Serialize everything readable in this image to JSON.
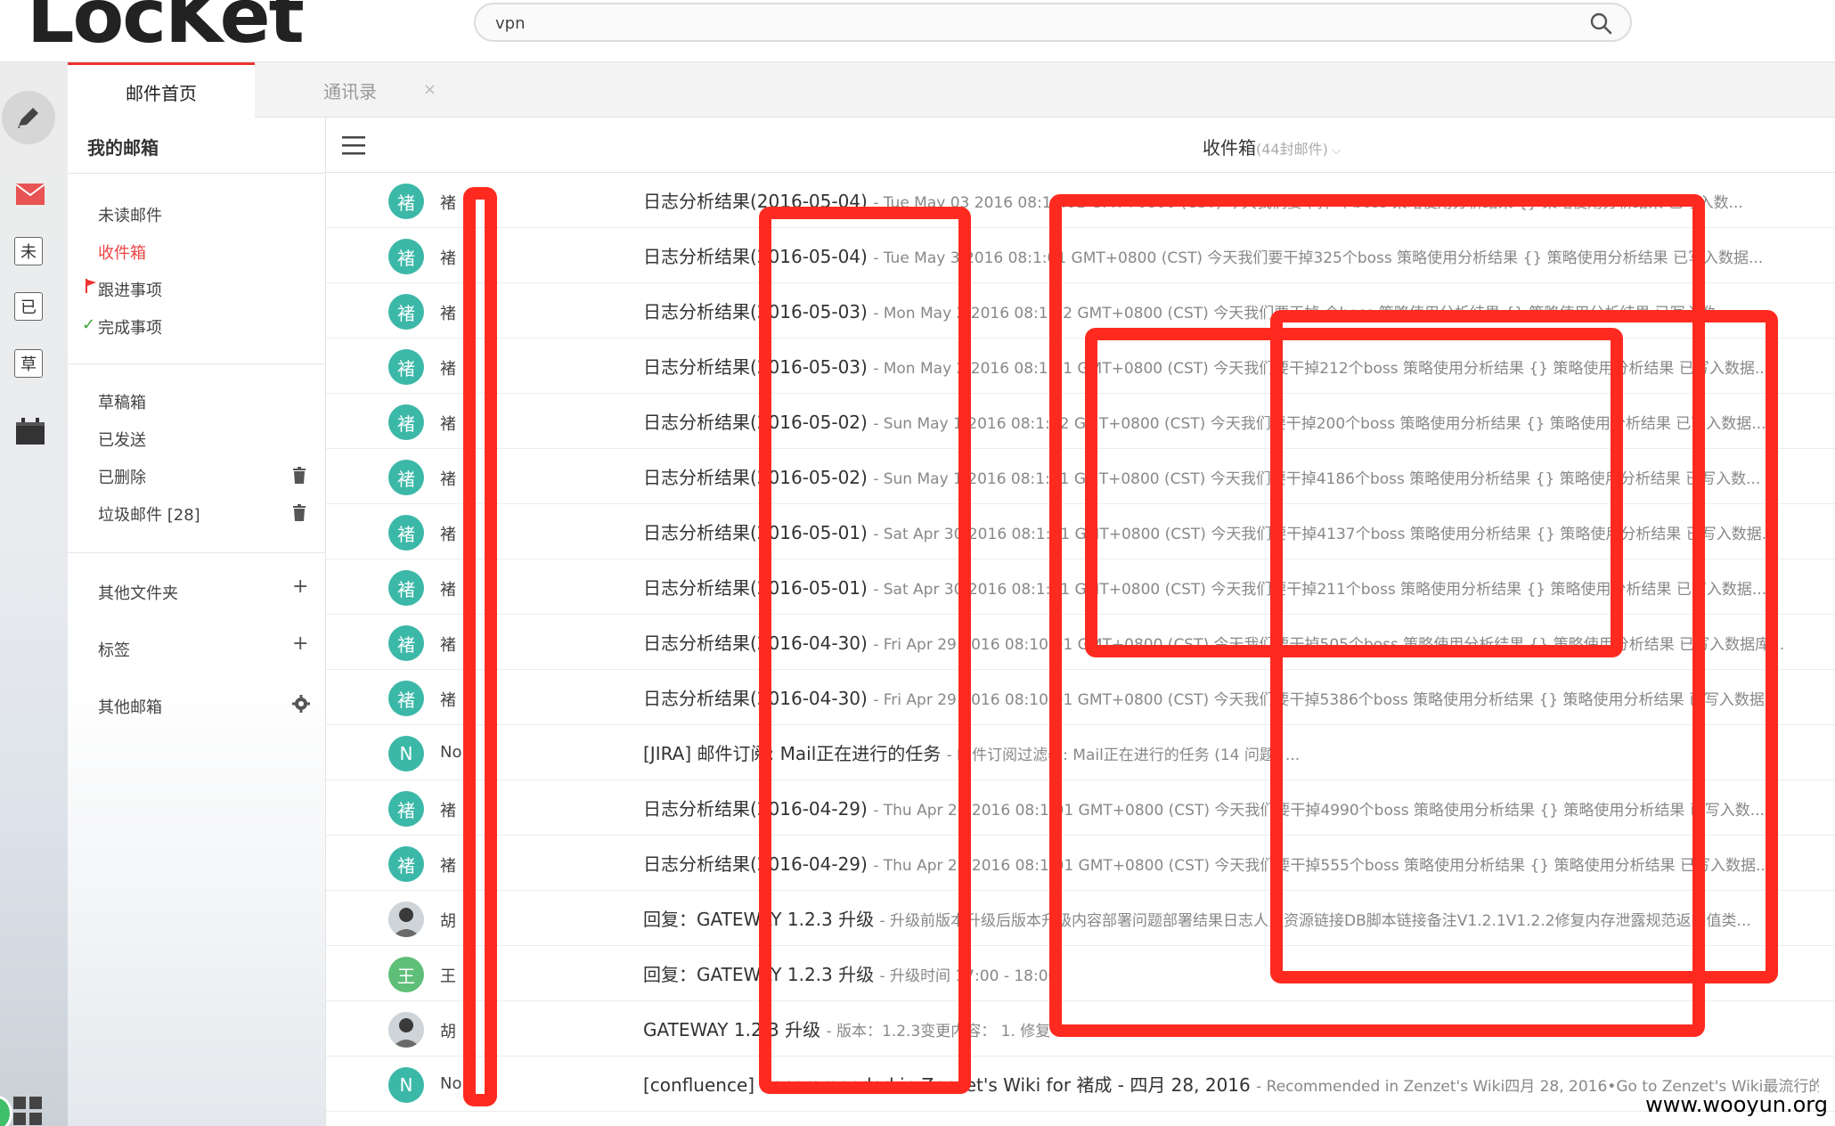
{
  "app": {
    "logo_text": "LocKet"
  },
  "search": {
    "value": "vpn",
    "placeholder": ""
  },
  "tabs": [
    {
      "label": "邮件首页",
      "active": true
    },
    {
      "label": "通讯录",
      "close": "×"
    }
  ],
  "sidebar_icons": [
    "compose-pencil",
    "mail",
    "未",
    "已",
    "草",
    "calendar"
  ],
  "folders": {
    "title": "我的邮箱",
    "quick": [
      {
        "label": "未读邮件"
      },
      {
        "label": "收件箱",
        "active": true
      },
      {
        "label": "跟进事项",
        "icon": "flag-icon"
      },
      {
        "label": "完成事项",
        "icon": "check-icon"
      }
    ],
    "mail": [
      {
        "label": "草稿箱"
      },
      {
        "label": "已发送"
      },
      {
        "label": "已删除",
        "icon": "trash-icon"
      },
      {
        "label": "垃圾邮件 [28]",
        "icon": "trash-icon"
      }
    ],
    "groups": [
      {
        "label": "其他文件夹",
        "action": "+"
      },
      {
        "label": "标签",
        "action": "+"
      },
      {
        "label": "其他邮箱",
        "action": "gear"
      }
    ]
  },
  "inbox": {
    "title": "收件箱",
    "count": "(44封邮件)"
  },
  "colors": {
    "accent_red": "#ff2a1f",
    "avatar_teal": "#3cb8a8",
    "avatar_green": "#5fbf78"
  },
  "messages": [
    {
      "avatar": "褚",
      "avatar_type": "teal",
      "sender": "褚",
      "subject": "日志分析结果(2016-05-04)",
      "preview": "- Tue May 03 2016 08:12:01 GMT+0800 (CST) 今天我们要干掉 个boss 策略使用分析结果 {} 策略使用分析结果 已写入数..."
    },
    {
      "avatar": "褚",
      "avatar_type": "teal",
      "sender": "褚",
      "subject": "日志分析结果(2016-05-04)",
      "preview": "- Tue May 3 2016 08:1:01 GMT+0800 (CST) 今天我们要干掉325个boss 策略使用分析结果 {} 策略使用分析结果 已写入数据..."
    },
    {
      "avatar": "褚",
      "avatar_type": "teal",
      "sender": "褚",
      "subject": "日志分析结果(2016-05-03)",
      "preview": "- Mon May 2 2016 08:1:02 GMT+0800 (CST) 今天我们要干掉 个boss 策略使用分析结果 {} 策略使用分析结果 已写入数..."
    },
    {
      "avatar": "褚",
      "avatar_type": "teal",
      "sender": "褚",
      "subject": "日志分析结果(2016-05-03)",
      "preview": "- Mon May 2 2016 08:1:01 GMT+0800 (CST) 今天我们要干掉212个boss 策略使用分析结果 {} 策略使用分析结果 已写入数据..."
    },
    {
      "avatar": "褚",
      "avatar_type": "teal",
      "sender": "褚",
      "subject": "日志分析结果(2016-05-02)",
      "preview": "- Sun May 1 2016 08:1:02 GMT+0800 (CST) 今天我们要干掉200个boss 策略使用分析结果 {} 策略使用分析结果 已写入数据..."
    },
    {
      "avatar": "褚",
      "avatar_type": "teal",
      "sender": "褚",
      "subject": "日志分析结果(2016-05-02)",
      "preview": "- Sun May 1 2016 08:1:01 GMT+0800 (CST) 今天我们要干掉4186个boss 策略使用分析结果 {} 策略使用分析结果 已写入数..."
    },
    {
      "avatar": "褚",
      "avatar_type": "teal",
      "sender": "褚",
      "subject": "日志分析结果(2016-05-01)",
      "preview": "- Sat Apr 30 2016 08:1:01 GMT+0800 (CST) 今天我们要干掉4137个boss 策略使用分析结果 {} 策略使用分析结果 已写入数据..."
    },
    {
      "avatar": "褚",
      "avatar_type": "teal",
      "sender": "褚",
      "subject": "日志分析结果(2016-05-01)",
      "preview": "- Sat Apr 30 2016 08:1:01 GMT+0800 (CST) 今天我们要干掉211个boss 策略使用分析结果 {} 策略使用分析结果 已写入数据..."
    },
    {
      "avatar": "褚",
      "avatar_type": "teal",
      "sender": "褚",
      "subject": "日志分析结果(2016-04-30)",
      "preview": "- Fri Apr 29 2016 08:10:01 GMT+0800 (CST) 今天我们要干掉505个boss 策略使用分析结果 {} 策略使用分析结果 已写入数据库..."
    },
    {
      "avatar": "褚",
      "avatar_type": "teal",
      "sender": "褚",
      "subject": "日志分析结果(2016-04-30)",
      "preview": "- Fri Apr 29 2016 08:10:01 GMT+0800 (CST) 今天我们要干掉5386个boss 策略使用分析结果 {} 策略使用分析结果 已写入数据..."
    },
    {
      "avatar": "N",
      "avatar_type": "teal",
      "sender": "No",
      "subject": "[JIRA] 邮件订阅: Mail正在进行的任务",
      "preview": "- 邮件订阅过滤器: Mail正在进行的任务 (14 问题) ..."
    },
    {
      "avatar": "褚",
      "avatar_type": "teal",
      "sender": "褚",
      "subject": "日志分析结果(2016-04-29)",
      "preview": "- Thu Apr 28 2016 08:1:01 GMT+0800 (CST) 今天我们要干掉4990个boss 策略使用分析结果 {} 策略使用分析结果 已写入数..."
    },
    {
      "avatar": "褚",
      "avatar_type": "teal",
      "sender": "褚",
      "subject": "日志分析结果(2016-04-29)",
      "preview": "- Thu Apr 28 2016 08:1:01 GMT+0800 (CST) 今天我们要干掉555个boss 策略使用分析结果 {} 策略使用分析结果 已写入数据..."
    },
    {
      "avatar": "",
      "avatar_type": "photo",
      "sender": "胡",
      "subject": "回复：GATEWAY 1.2.3 升级",
      "preview": "- 升级前版本升级后版本升级内容部署问题部署结果日志人员资源链接DB脚本链接备注V1.2.1V1.2.2修复内存泄露规范返回值类..."
    },
    {
      "avatar": "王",
      "avatar_type": "green",
      "sender": "王",
      "subject": "回复：GATEWAY 1.2.3 升级",
      "preview": "- 升级时间 17:00 - 18:00"
    },
    {
      "avatar": "",
      "avatar_type": "photo",
      "sender": "胡",
      "subject": "GATEWAY 1.2.3 升级",
      "preview": "- 版本：1.2.3变更内容： 1. 修复 ... OPERATIONS-3 ..."
    },
    {
      "avatar": "N",
      "avatar_type": "teal",
      "sender": "No",
      "subject": "[confluence] Recommended in Zenzet's Wiki for 褚成 - 四月 28, 2016",
      "preview": "- Recommended in Zenzet's Wiki四月 28, 2016•Go to Zenzet's Wiki最流行的1..."
    }
  ],
  "watermark": "www.wooyun.org"
}
